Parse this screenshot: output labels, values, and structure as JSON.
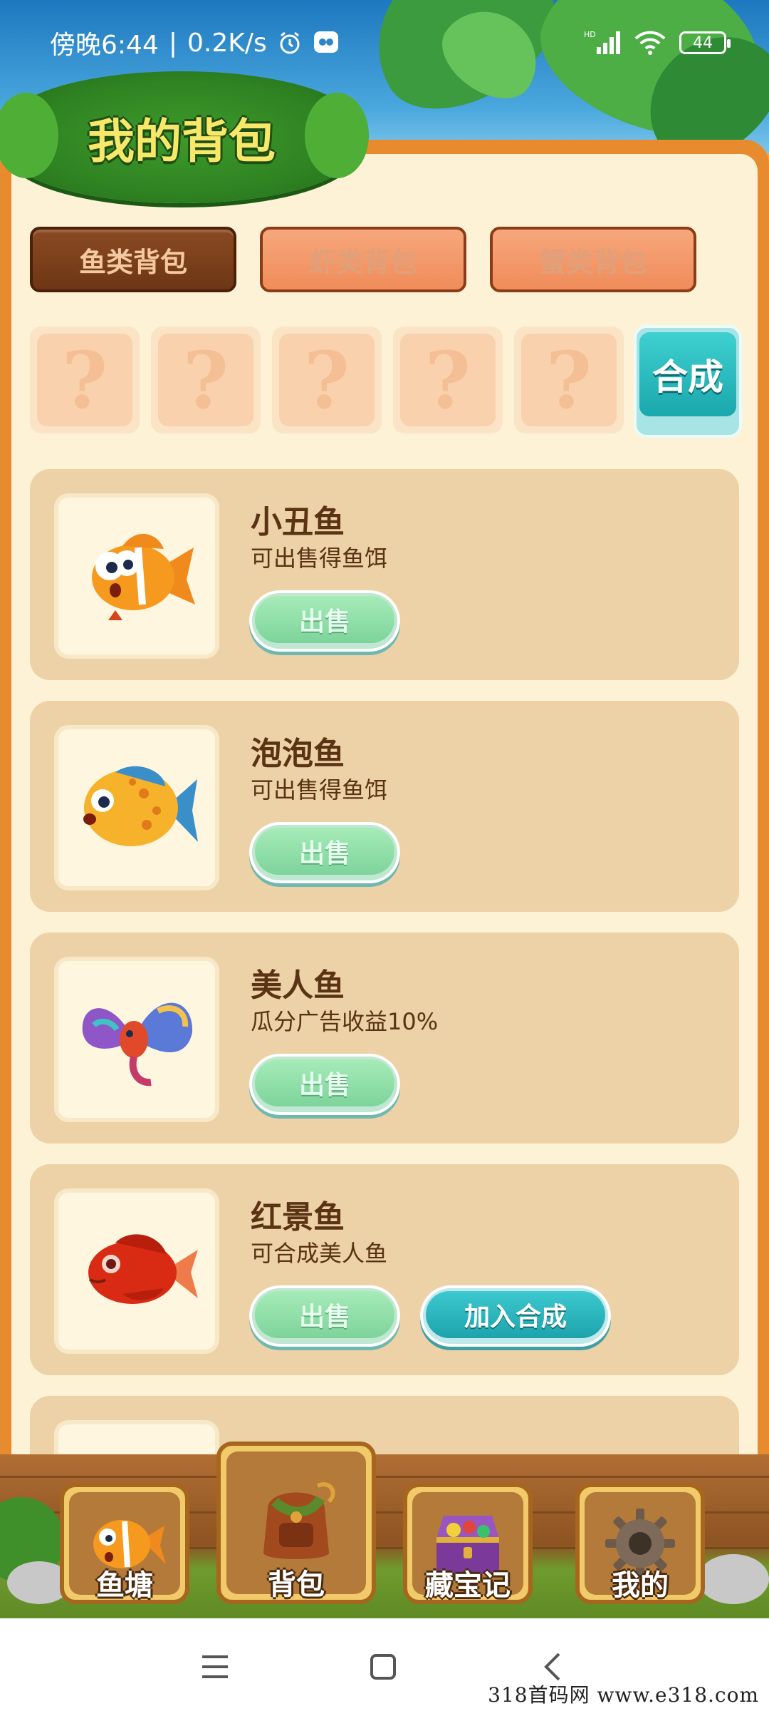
{
  "status_bar": {
    "time": "傍晚6:44",
    "speed": "0.2K/s",
    "network": "HD",
    "battery": "44"
  },
  "header": {
    "title": "我的背包"
  },
  "tabs": [
    {
      "label": "鱼类背包",
      "active": true
    },
    {
      "label": "虾类背包",
      "active": false
    },
    {
      "label": "蟹类背包",
      "active": false
    }
  ],
  "slots": {
    "placeholder": "?",
    "count": 5,
    "combine_label": "合成"
  },
  "items": [
    {
      "name": "小丑鱼",
      "desc": "可出售得鱼饵",
      "sell_label": "出售"
    },
    {
      "name": "泡泡鱼",
      "desc": "可出售得鱼饵",
      "sell_label": "出售"
    },
    {
      "name": "美人鱼",
      "desc": "瓜分广告收益10%",
      "sell_label": "出售"
    },
    {
      "name": "红景鱼",
      "desc": "可合成美人鱼",
      "sell_label": "出售",
      "add_label": "加入合成"
    }
  ],
  "bottom_nav": [
    {
      "label": "鱼塘",
      "icon": "clownfish-icon",
      "active": false
    },
    {
      "label": "背包",
      "icon": "backpack-icon",
      "active": true
    },
    {
      "label": "藏宝记",
      "icon": "treasure-chest-icon",
      "active": false
    },
    {
      "label": "我的",
      "icon": "gear-icon",
      "active": false
    }
  ],
  "watermark": "318首码网  www.e318.com",
  "colors": {
    "panel_bg": "#fdf1d6",
    "card_bg": "#ecd2a6",
    "accent_teal": "#1ea3ab",
    "title_yellow": "#f7e86a",
    "text_brown": "#5a3214"
  }
}
